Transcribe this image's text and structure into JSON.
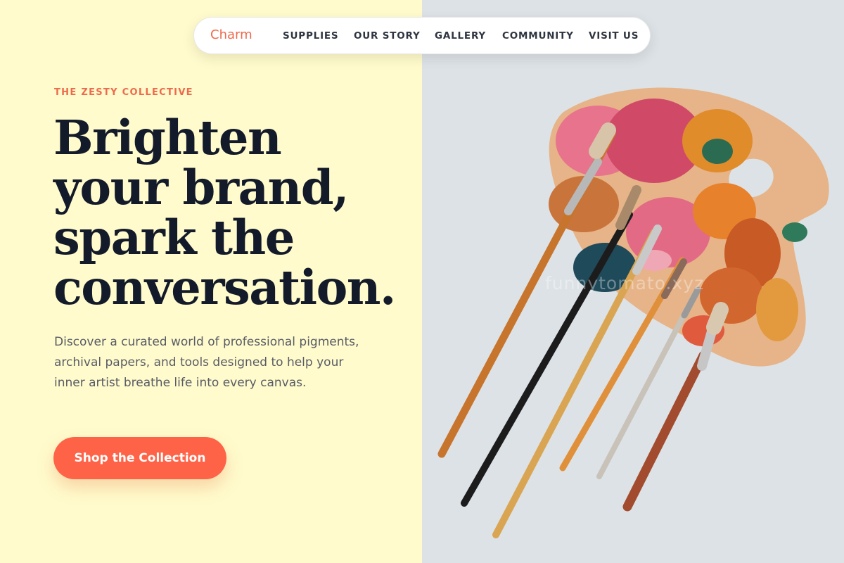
{
  "nav": {
    "logo": "Charm",
    "items": [
      {
        "label": "SUPPLIES"
      },
      {
        "label": "OUR STORY"
      },
      {
        "label": "GALLERY"
      },
      {
        "label": "COMMUNITY"
      },
      {
        "label": "VISIT US"
      }
    ]
  },
  "hero": {
    "eyebrow": "THE ZESTY COLLECTIVE",
    "headline_lines": [
      "Brighten",
      "your brand,",
      "spark the",
      "conversation."
    ],
    "description": "Discover a curated world of professional pigments, archival papers, and tools designed to help your inner artist breathe life into every canvas.",
    "cta_label": "Shop the Collection"
  },
  "image": {
    "watermark": "funnytomato.xyz"
  },
  "colors": {
    "accent": "#ff6347",
    "left_background": "#fffbcc",
    "right_background": "#dde2e6",
    "heading": "#131b2b"
  }
}
